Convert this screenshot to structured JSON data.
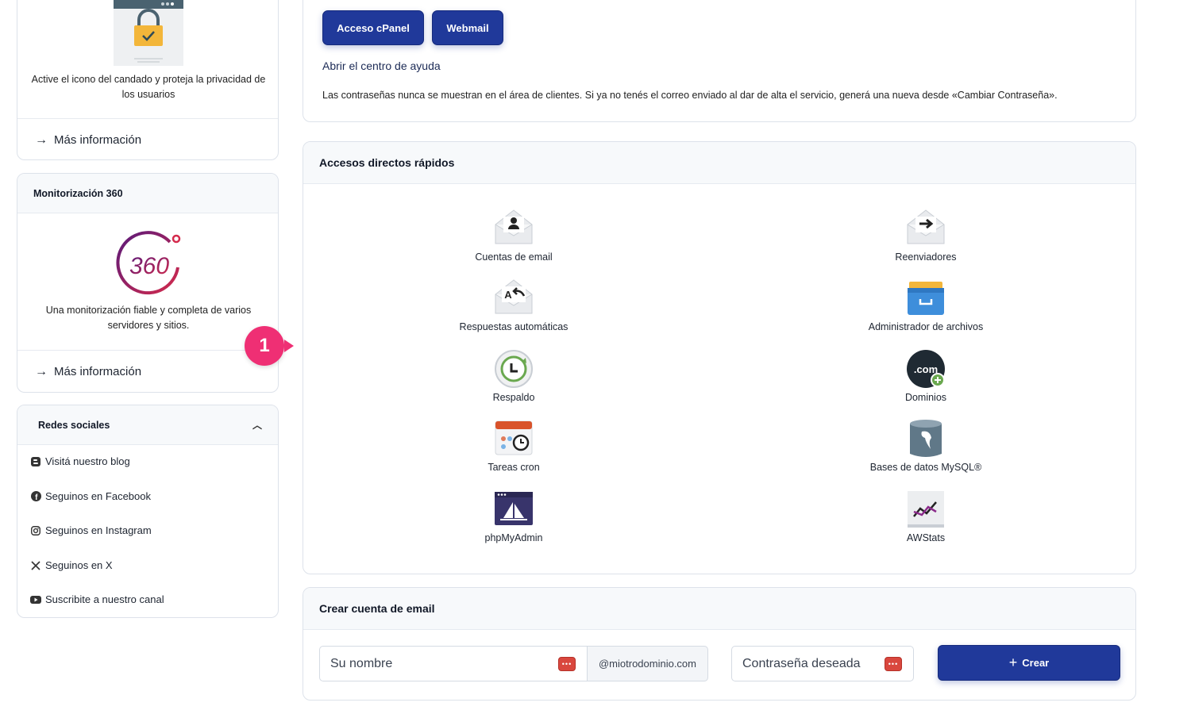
{
  "left": {
    "ssl": {
      "description": "Active el icono del candado y proteja la privacidad de los usuarios",
      "more": "Más información"
    },
    "monitoring": {
      "title": "Monitorización 360",
      "description": "Una monitorización fiable y completa de varios servidores y sitios.",
      "more": "Más información"
    },
    "social": {
      "title": "Redes sociales",
      "items": [
        {
          "label": "Visitá nuestro blog",
          "icon": "blogger-icon"
        },
        {
          "label": "Seguinos en Facebook",
          "icon": "facebook-icon"
        },
        {
          "label": "Seguinos en Instagram",
          "icon": "instagram-icon"
        },
        {
          "label": "Seguinos en X",
          "icon": "x-icon"
        },
        {
          "label": "Suscribite a nuestro canal",
          "icon": "youtube-icon"
        }
      ]
    }
  },
  "badge": {
    "number": "1",
    "color": "#ef2f74"
  },
  "top": {
    "cpanel_button": "Acceso cPanel",
    "webmail_button": "Webmail",
    "help_link": "Abrir el centro de ayuda",
    "password_note": "Las contraseñas nunca se muestran en el área de clientes. Si ya no tenés el correo enviado al dar de alta el servicio, generá una nueva desde «Cambiar Contraseña»."
  },
  "shortcuts": {
    "title": "Accesos directos rápidos",
    "items": [
      {
        "label": "Cuentas de email",
        "icon": "email-account-icon"
      },
      {
        "label": "Reenviadores",
        "icon": "forwarder-icon"
      },
      {
        "label": "Respuestas automáticas",
        "icon": "autoresponder-icon"
      },
      {
        "label": "Administrador de archivos",
        "icon": "file-manager-icon"
      },
      {
        "label": "Respaldo",
        "icon": "backup-icon"
      },
      {
        "label": "Dominios",
        "icon": "domains-icon"
      },
      {
        "label": "Tareas cron",
        "icon": "cron-icon"
      },
      {
        "label": "Bases de datos MySQL®",
        "icon": "mysql-icon"
      },
      {
        "label": "phpMyAdmin",
        "icon": "phpmyadmin-icon"
      },
      {
        "label": "AWStats",
        "icon": "awstats-icon"
      }
    ]
  },
  "create_email": {
    "title": "Crear cuenta de email",
    "name_placeholder": "Su nombre",
    "domain_suffix": "@miotrodominio.com",
    "password_placeholder": "Contraseña deseada",
    "create_button": "Crear"
  },
  "colors": {
    "primary": "#20399a",
    "badge": "#ef2f74",
    "card_border": "#dde2ea"
  }
}
